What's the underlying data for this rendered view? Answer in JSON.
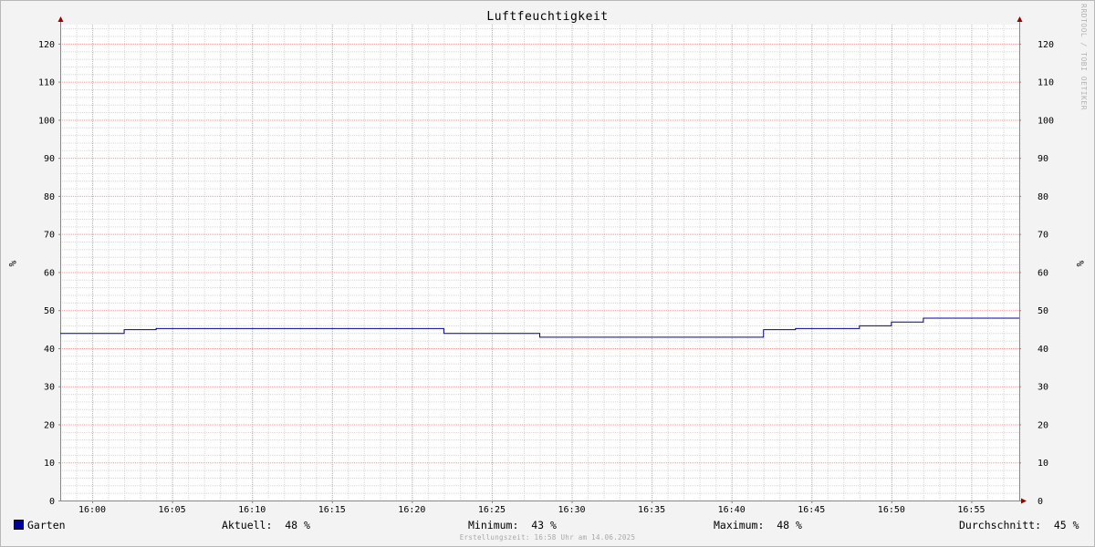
{
  "chart_data": {
    "type": "line",
    "title": "Luftfeuchtigkeit",
    "ylabel_left": "%",
    "ylabel_right": "%",
    "ylim": [
      0,
      125
    ],
    "y_ticks": [
      0,
      10,
      20,
      30,
      40,
      50,
      60,
      70,
      80,
      90,
      100,
      110,
      120
    ],
    "x_range_min": [
      -1,
      59
    ],
    "x_ticks": [
      {
        "min": 1,
        "label": "16:00"
      },
      {
        "min": 6,
        "label": "16:05"
      },
      {
        "min": 11,
        "label": "16:10"
      },
      {
        "min": 16,
        "label": "16:15"
      },
      {
        "min": 21,
        "label": "16:20"
      },
      {
        "min": 26,
        "label": "16:25"
      },
      {
        "min": 31,
        "label": "16:30"
      },
      {
        "min": 36,
        "label": "16:35"
      },
      {
        "min": 41,
        "label": "16:40"
      },
      {
        "min": 46,
        "label": "16:45"
      },
      {
        "min": 51,
        "label": "16:50"
      },
      {
        "min": 56,
        "label": "16:55"
      }
    ],
    "grid": true,
    "series": [
      {
        "name": "Garten",
        "color": "#00009c",
        "points": [
          {
            "t": -1,
            "v": 44
          },
          {
            "t": 3,
            "v": 45
          },
          {
            "t": 5,
            "v": 45.3
          },
          {
            "t": 23,
            "v": 44
          },
          {
            "t": 29,
            "v": 43
          },
          {
            "t": 43,
            "v": 45
          },
          {
            "t": 45,
            "v": 45.3
          },
          {
            "t": 49,
            "v": 46
          },
          {
            "t": 51,
            "v": 47
          },
          {
            "t": 53,
            "v": 48
          },
          {
            "t": 59,
            "v": 48
          }
        ]
      }
    ]
  },
  "legend": {
    "series_name": "Garten",
    "aktuell_label": "Aktuell:",
    "aktuell_value": "48 %",
    "minimum_label": "Minimum:",
    "minimum_value": "43 %",
    "maximum_label": "Maximum:",
    "maximum_value": "48 %",
    "durchschnitt_label": "Durchschnitt:",
    "durchschnitt_value": "45 %"
  },
  "footer": "Erstellungszeit: 16:58 Uhr am 14.06.2025",
  "watermark": "RRDTOOL / TOBI OETIKER",
  "colors": {
    "major_grid": "#e8a0a0",
    "minor_grid": "#d8d8d8",
    "axis": "#888888",
    "arrow": "#990000"
  }
}
